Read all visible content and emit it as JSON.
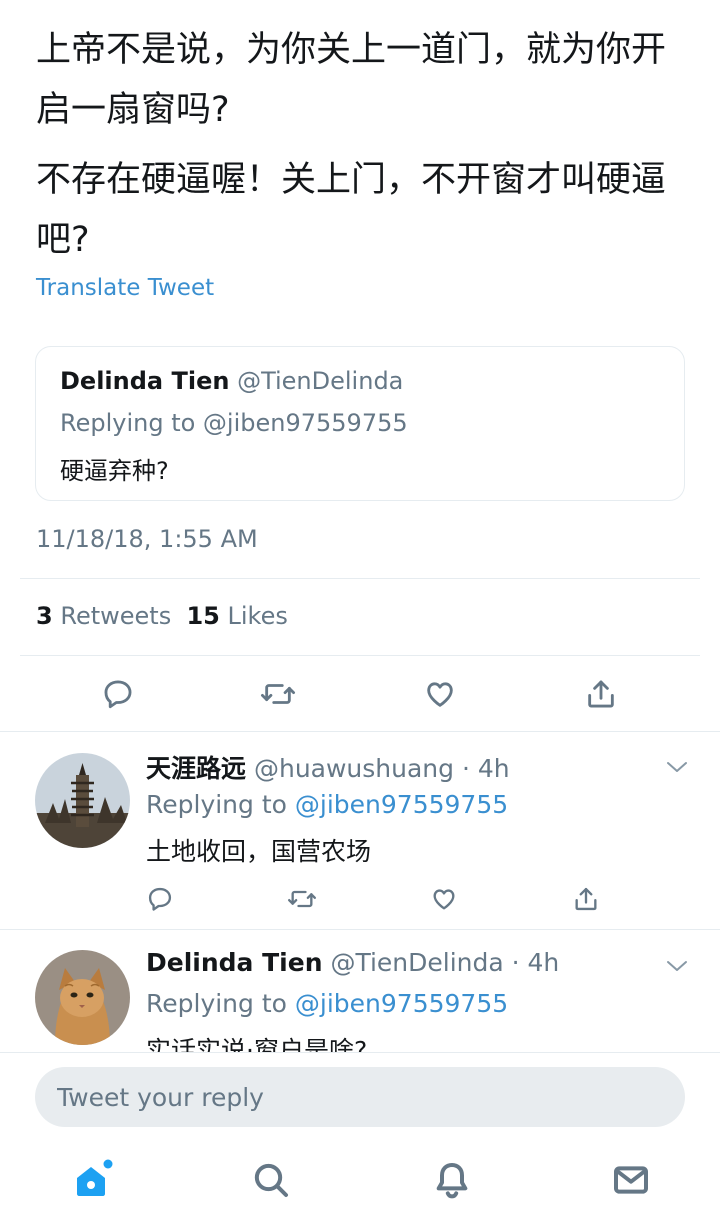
{
  "tweet": {
    "text_line1": "上帝不是说，为你关上一道门，就为你开启一扇窗吗?",
    "text_line2": "不存在硬逼喔！关上门，不开窗才叫硬逼吧?",
    "translate_label": "Translate Tweet",
    "quoted": {
      "name": "Delinda Tien",
      "handle": "@TienDelinda",
      "replying": "Replying to @jiben97559755",
      "text": "硬逼弃种?"
    },
    "timestamp": "11/18/18, 1:55 AM",
    "retweets_count": "3",
    "retweets_label": "Retweets",
    "likes_count": "15",
    "likes_label": "Likes"
  },
  "replies": [
    {
      "name": "天涯路远",
      "meta": "@huawushuang · 4h",
      "replying_prefix": "Replying to",
      "replying_handle": "@jiben97559755",
      "text": "土地收回，国营农场",
      "avatar_icon": "pagoda-photo-avatar"
    },
    {
      "name": "Delinda Tien",
      "meta": "@TienDelinda · 4h",
      "replying_prefix": "Replying to",
      "replying_handle": "@jiben97559755",
      "text": "实话实说·窗户是啥?",
      "avatar_icon": "cat-photo-avatar"
    }
  ],
  "composer": {
    "placeholder": "Tweet your reply"
  },
  "tabs": [
    "home-icon",
    "search-icon",
    "notifications-icon",
    "messages-icon"
  ],
  "colors": {
    "accent": "#1da1f2",
    "link": "#3a8fd0",
    "secondary_text": "#657786",
    "divider": "#e6ecf0"
  }
}
